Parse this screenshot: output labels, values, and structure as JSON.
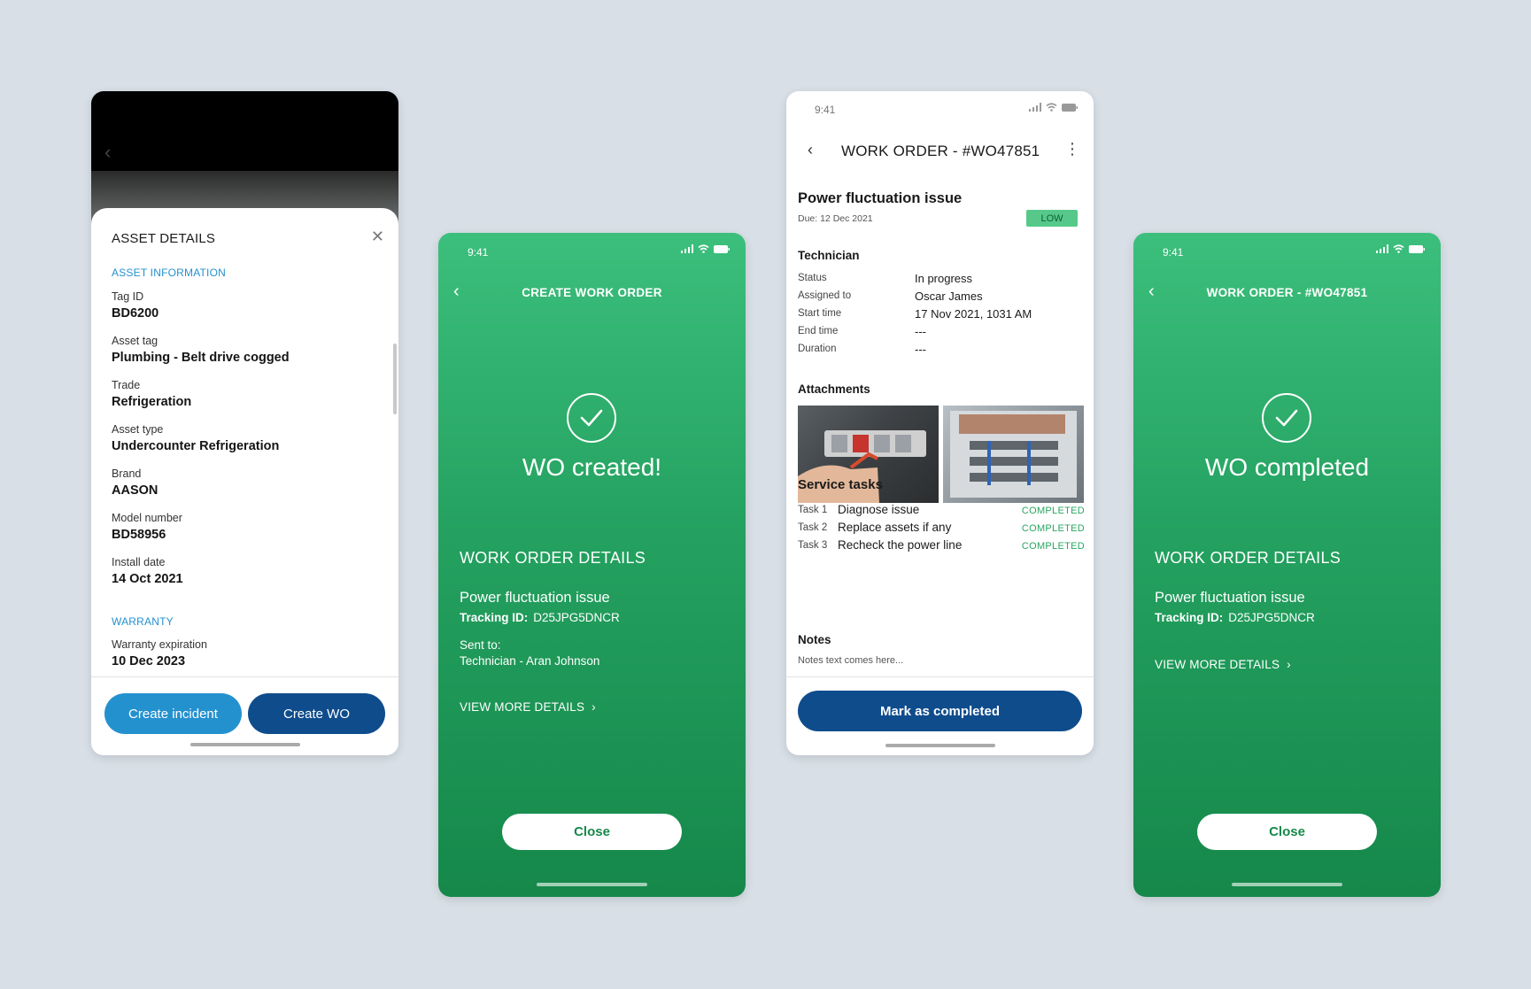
{
  "colors": {
    "background": "#d8dfe6",
    "accent_blue": "#2491cf",
    "dark_blue": "#0f4c8c",
    "green": "#24a160",
    "low_badge": "#56c98a",
    "completed": "#2aa562"
  },
  "asset_details": {
    "title": "ASSET DETAILS",
    "section_info": "ASSET INFORMATION",
    "fields": [
      {
        "label": "Tag ID",
        "value": "BD6200"
      },
      {
        "label": "Asset tag",
        "value": "Plumbing - Belt drive cogged"
      },
      {
        "label": "Trade",
        "value": "Refrigeration"
      },
      {
        "label": "Asset type",
        "value": "Undercounter Refrigeration"
      },
      {
        "label": "Brand",
        "value": "AASON"
      },
      {
        "label": "Model number",
        "value": "BD58956"
      },
      {
        "label": "Install date",
        "value": "14 Oct 2021"
      }
    ],
    "section_warranty": "WARRANTY",
    "warranty": {
      "label": "Warranty expiration",
      "value": "10 Dec 2023"
    },
    "btn_incident": "Create incident",
    "btn_wo": "Create WO"
  },
  "create_wo": {
    "time": "9:41",
    "header": "CREATE WORK ORDER",
    "message": "WO created!",
    "details_heading": "WORK ORDER DETAILS",
    "issue": "Power fluctuation issue",
    "tracking_label": "Tracking ID:",
    "tracking_id": "D25JPG5DNCR",
    "sent_to_label": "Sent to:",
    "sent_to_value": "Technician - Aran Johnson",
    "view_more": "VIEW MORE DETAILS",
    "close": "Close"
  },
  "work_order": {
    "time": "9:41",
    "header": "WORK ORDER - #WO47851",
    "issue": "Power fluctuation issue",
    "due": "Due: 12 Dec 2021",
    "priority": "LOW",
    "technician_heading": "Technician",
    "technician": [
      {
        "label": "Status",
        "value": "In progress"
      },
      {
        "label": "Assigned to",
        "value": "Oscar James"
      },
      {
        "label": "Start time",
        "value": "17 Nov 2021, 1031 AM"
      },
      {
        "label": "End time",
        "value": "---"
      },
      {
        "label": "Duration",
        "value": "---"
      }
    ],
    "attachments_heading": "Attachments",
    "tasks_heading": "Service tasks",
    "tasks": [
      {
        "num": "Task 1",
        "title": "Diagnose issue",
        "status": "COMPLETED"
      },
      {
        "num": "Task 2",
        "title": "Replace assets if any",
        "status": "COMPLETED"
      },
      {
        "num": "Task 3",
        "title": "Recheck the power line",
        "status": "COMPLETED"
      }
    ],
    "notes_heading": "Notes",
    "notes_text": "Notes text comes here...",
    "mark_completed": "Mark as completed"
  },
  "wo_completed": {
    "time": "9:41",
    "header": "WORK ORDER - #WO47851",
    "message": "WO completed",
    "details_heading": "WORK ORDER DETAILS",
    "issue": "Power fluctuation issue",
    "tracking_label": "Tracking ID:",
    "tracking_id": "D25JPG5DNCR",
    "view_more": "VIEW MORE DETAILS",
    "close": "Close"
  }
}
